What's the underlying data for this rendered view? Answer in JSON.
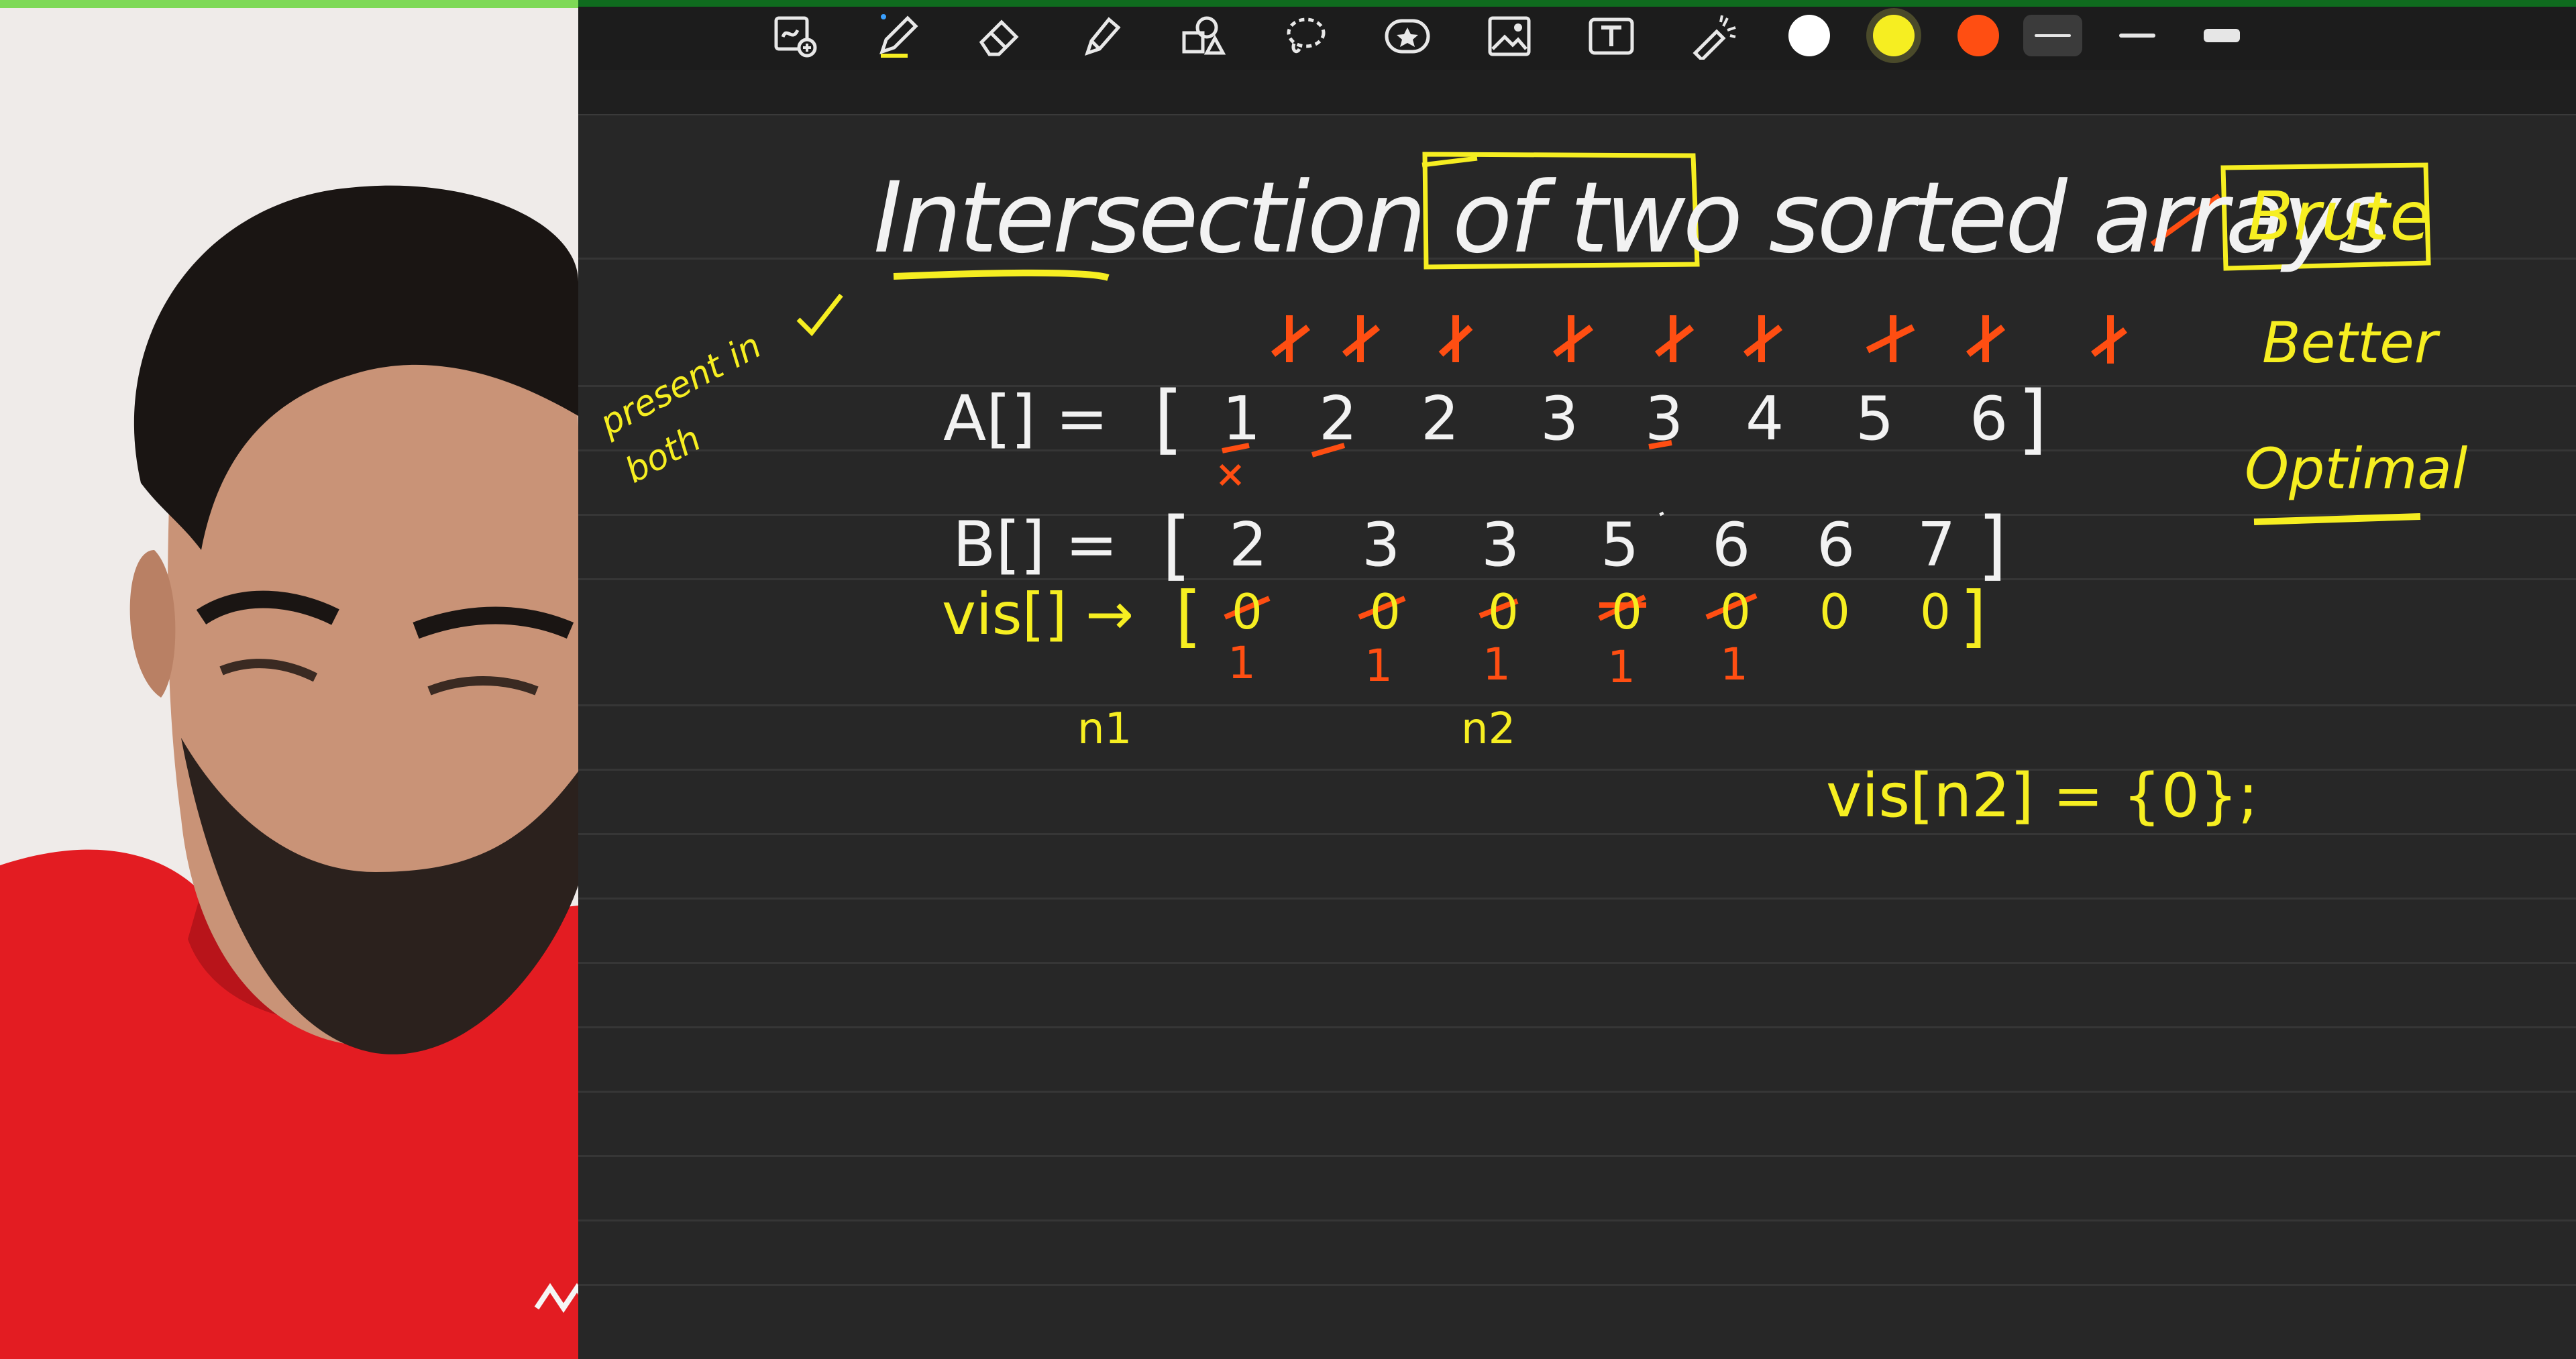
{
  "toolbar": {
    "tools": [
      {
        "icon": "zoom-lasso-icon"
      },
      {
        "icon": "pen-icon",
        "active": true
      },
      {
        "icon": "eraser-icon"
      },
      {
        "icon": "highlighter-icon"
      },
      {
        "icon": "shapes-icon"
      },
      {
        "icon": "lasso-icon"
      },
      {
        "icon": "sticker-icon"
      },
      {
        "icon": "image-icon"
      },
      {
        "icon": "text-box-icon"
      },
      {
        "icon": "laser-pointer-icon"
      }
    ],
    "colors": [
      "#ffffff",
      "#f6ee21",
      "#ff4e12"
    ],
    "selected_color": "#f6ee21",
    "stroke_widths": [
      "thin",
      "medium",
      "thick"
    ],
    "selected_stroke": "thin"
  },
  "notes": {
    "title": "Intersection of two sorted arrays",
    "approaches": [
      "Brute",
      "Better",
      "Optimal"
    ],
    "side_note": "present in both",
    "array_a": {
      "label": "A[] =",
      "values": [
        "1",
        "2",
        "2",
        "3",
        "3",
        "4",
        "5",
        "6"
      ]
    },
    "array_b": {
      "label": "B[] =",
      "values": [
        "2",
        "3",
        "3",
        "5",
        "6",
        "6",
        "7"
      ]
    },
    "vis": {
      "label": "vis[] →",
      "values": [
        "0",
        "0",
        "0",
        "0",
        "0",
        "0",
        "0"
      ],
      "marked": [
        "1",
        "1",
        "1",
        "1",
        "1"
      ]
    },
    "sizes": [
      "n1",
      "n2"
    ],
    "declaration": "vis[n2] = {0};"
  },
  "colors": {
    "ink_white": "#f2f2f2",
    "ink_yellow": "#f6ee21",
    "ink_orange": "#ff4e12",
    "canvas": "#272727",
    "toolbar": "#1c1c1c"
  }
}
